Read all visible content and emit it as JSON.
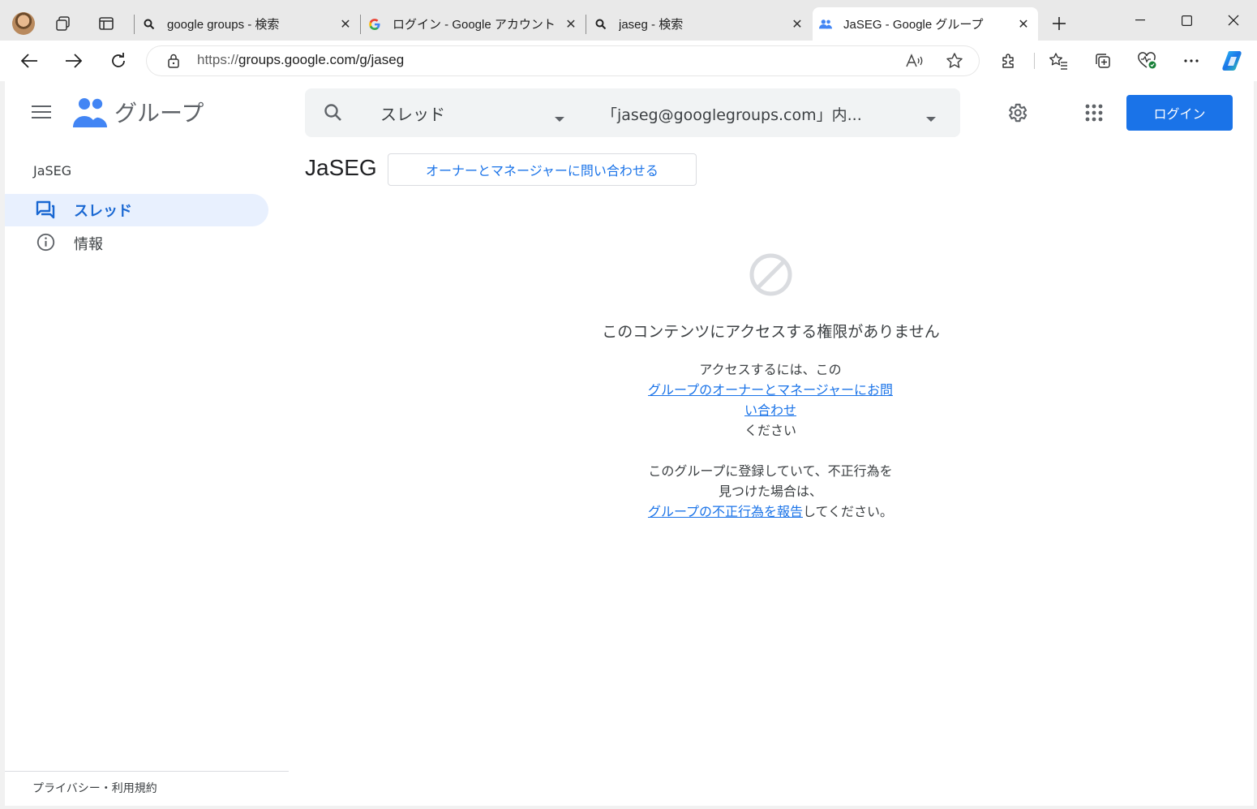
{
  "browser": {
    "tabs": [
      {
        "title": "google groups - 検索",
        "favicon": "search-icon",
        "active": false
      },
      {
        "title": "ログイン - Google アカウント",
        "favicon": "google-g-icon",
        "active": false
      },
      {
        "title": "jaseg - 検索",
        "favicon": "search-icon",
        "active": false
      },
      {
        "title": "JaSEG - Google グループ",
        "favicon": "groups-icon",
        "active": true
      }
    ],
    "address_prefix": "https://",
    "address_main": "groups.google.com/g/jaseg"
  },
  "app": {
    "product_name": "グループ",
    "search": {
      "scope_label": "スレッド",
      "context_label": "「jaseg@googlegroups.com」内..."
    },
    "login_label": "ログイン",
    "accent_color": "#1a73e8"
  },
  "sidebar": {
    "group_name": "JaSEG",
    "items": [
      {
        "label": "スレッド",
        "icon": "threads-icon",
        "active": true
      },
      {
        "label": "情報",
        "icon": "info-icon",
        "active": false
      }
    ],
    "footer": "プライバシー・利用規約"
  },
  "main": {
    "group_title": "JaSEG",
    "contact_button": "オーナーとマネージャーに問い合わせる",
    "denied": {
      "icon": "blocked-icon",
      "heading": "このコンテンツにアクセスする権限がありません",
      "access_line1": "アクセスするには、この",
      "access_link_line1": "グループのオーナーとマネージャーにお問",
      "access_link_line2": "い合わせ",
      "access_line3": "ください",
      "abuse_line1": "このグループに登録していて、不正行為を",
      "abuse_line2": "見つけた場合は、",
      "abuse_link": "グループの不正行為を報告",
      "abuse_tail": "してください。"
    }
  }
}
